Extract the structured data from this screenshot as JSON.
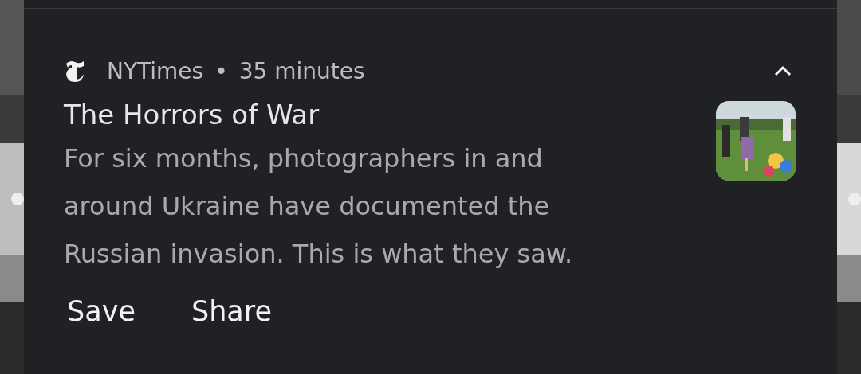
{
  "notification": {
    "app": "NYTimes",
    "separator": "•",
    "time": "35 minutes",
    "expanded": true,
    "title": "The Horrors of War",
    "body": "For six months, photographers in and around Ukraine have documented the Russian invasion. This is what they saw.",
    "actions": [
      "Save",
      "Share"
    ]
  }
}
